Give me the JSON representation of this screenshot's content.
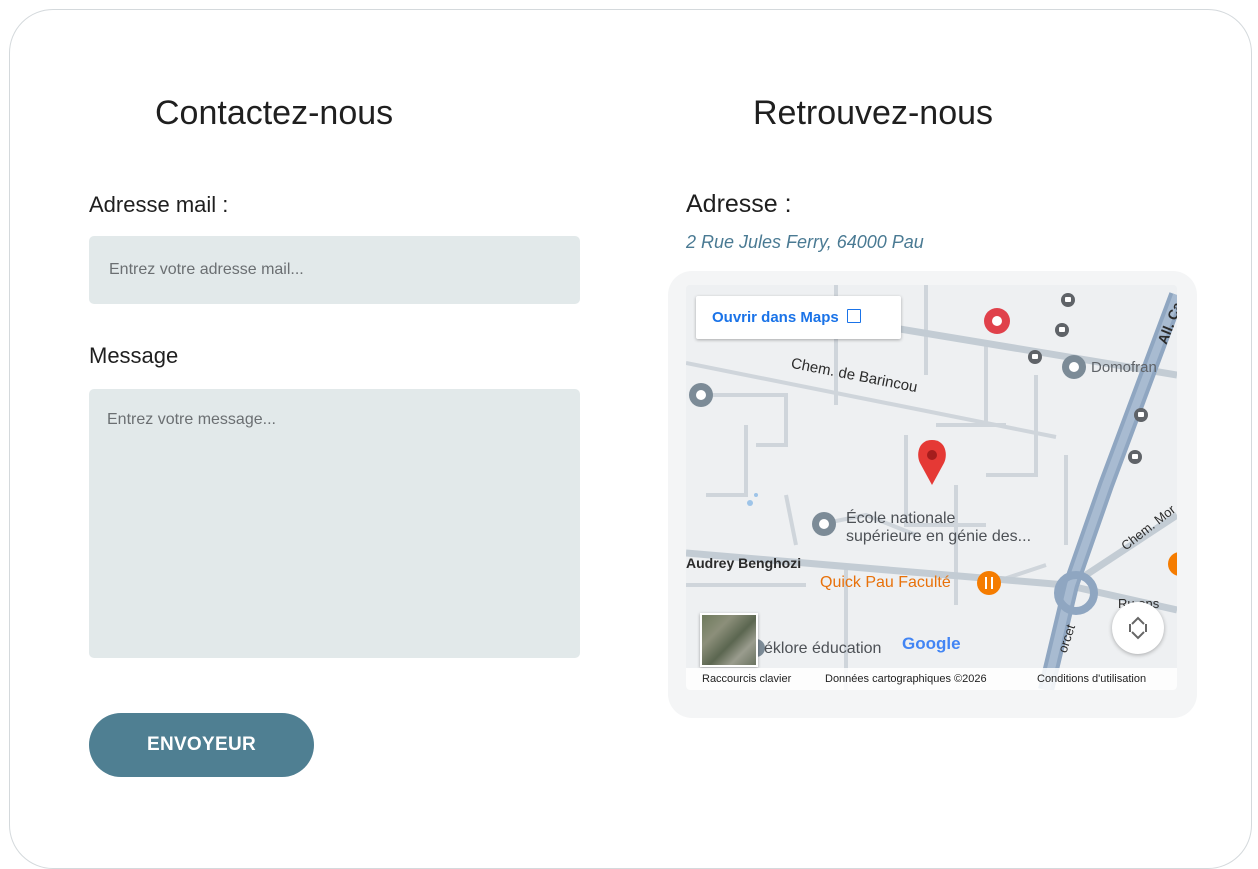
{
  "contact": {
    "title": "Contactez-nous",
    "email_label": "Adresse mail :",
    "email_placeholder": "Entrez votre adresse mail...",
    "message_label": "Message",
    "message_placeholder": "Entrez votre message...",
    "submit_label": "ENVOYEUR",
    "submit_color": "#4f7f92"
  },
  "location": {
    "title": "Retrouvez-nous",
    "address_label": "Adresse :",
    "address_value": "2 Rue Jules Ferry, 64000 Pau",
    "address_color": "#4a7a93"
  },
  "map": {
    "open_in_maps": "Ouvrir dans Maps",
    "streets": {
      "barincou": "Chem. de Barincou",
      "audrey": "Audrey Benghozi",
      "all_ca": "All. Ca",
      "chem_mor": "Chem. Mor",
      "ru_ons": "Ru  ons",
      "forcet": "orcet"
    },
    "places": {
      "domofran": "Domofran",
      "ecole_1": "École nationale",
      "ecole_2": "supérieure en génie des...",
      "quick": "Quick Pau Faculté",
      "eklore": "éklore éducation"
    },
    "footer": {
      "shortcuts": "Raccourcis clavier",
      "data": "Données cartographiques ©2026",
      "terms": "Conditions d'utilisation"
    },
    "logo": "Google",
    "marker_color": "#e53935",
    "food_color": "#f57c00"
  }
}
